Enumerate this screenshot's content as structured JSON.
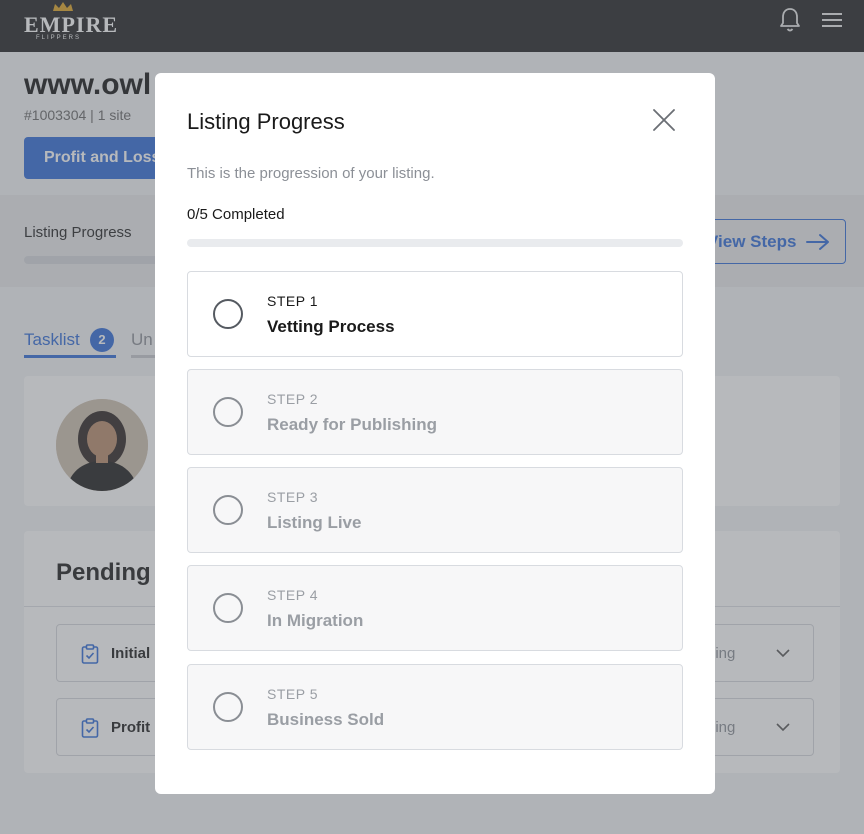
{
  "header": {
    "logo_text": "EMPIRE",
    "logo_subtext": "FLIPPERS",
    "bell_icon": "bell-icon",
    "menu_icon": "hamburger-menu-icon"
  },
  "listing": {
    "site_title": "www.owl",
    "meta": "#1003304 | 1 site",
    "pl_button": "Profit and Loss",
    "progress_label": "Listing Progress",
    "view_steps": "View Steps",
    "tabs": {
      "tasklist": "Tasklist",
      "tasklist_count": "2",
      "other": "Un"
    },
    "pending_title": "Pending T",
    "tasks": [
      {
        "label": "Initial",
        "status": "ding"
      },
      {
        "label": "Profit",
        "status": "ding"
      }
    ]
  },
  "modal": {
    "title": "Listing Progress",
    "description": "This is the progression of your listing.",
    "completed_text": "0/5 Completed",
    "progress_fraction": 0,
    "steps": [
      {
        "num": "STEP 1",
        "name": "Vetting Process",
        "active": true
      },
      {
        "num": "STEP 2",
        "name": "Ready for Publishing",
        "active": false
      },
      {
        "num": "STEP 3",
        "name": "Listing Live",
        "active": false
      },
      {
        "num": "STEP 4",
        "name": "In Migration",
        "active": false
      },
      {
        "num": "STEP 5",
        "name": "Business Sold",
        "active": false
      }
    ]
  },
  "colors": {
    "accent": "#2f6bd8",
    "topbar": "#1f2022",
    "gold": "#e0a521"
  }
}
